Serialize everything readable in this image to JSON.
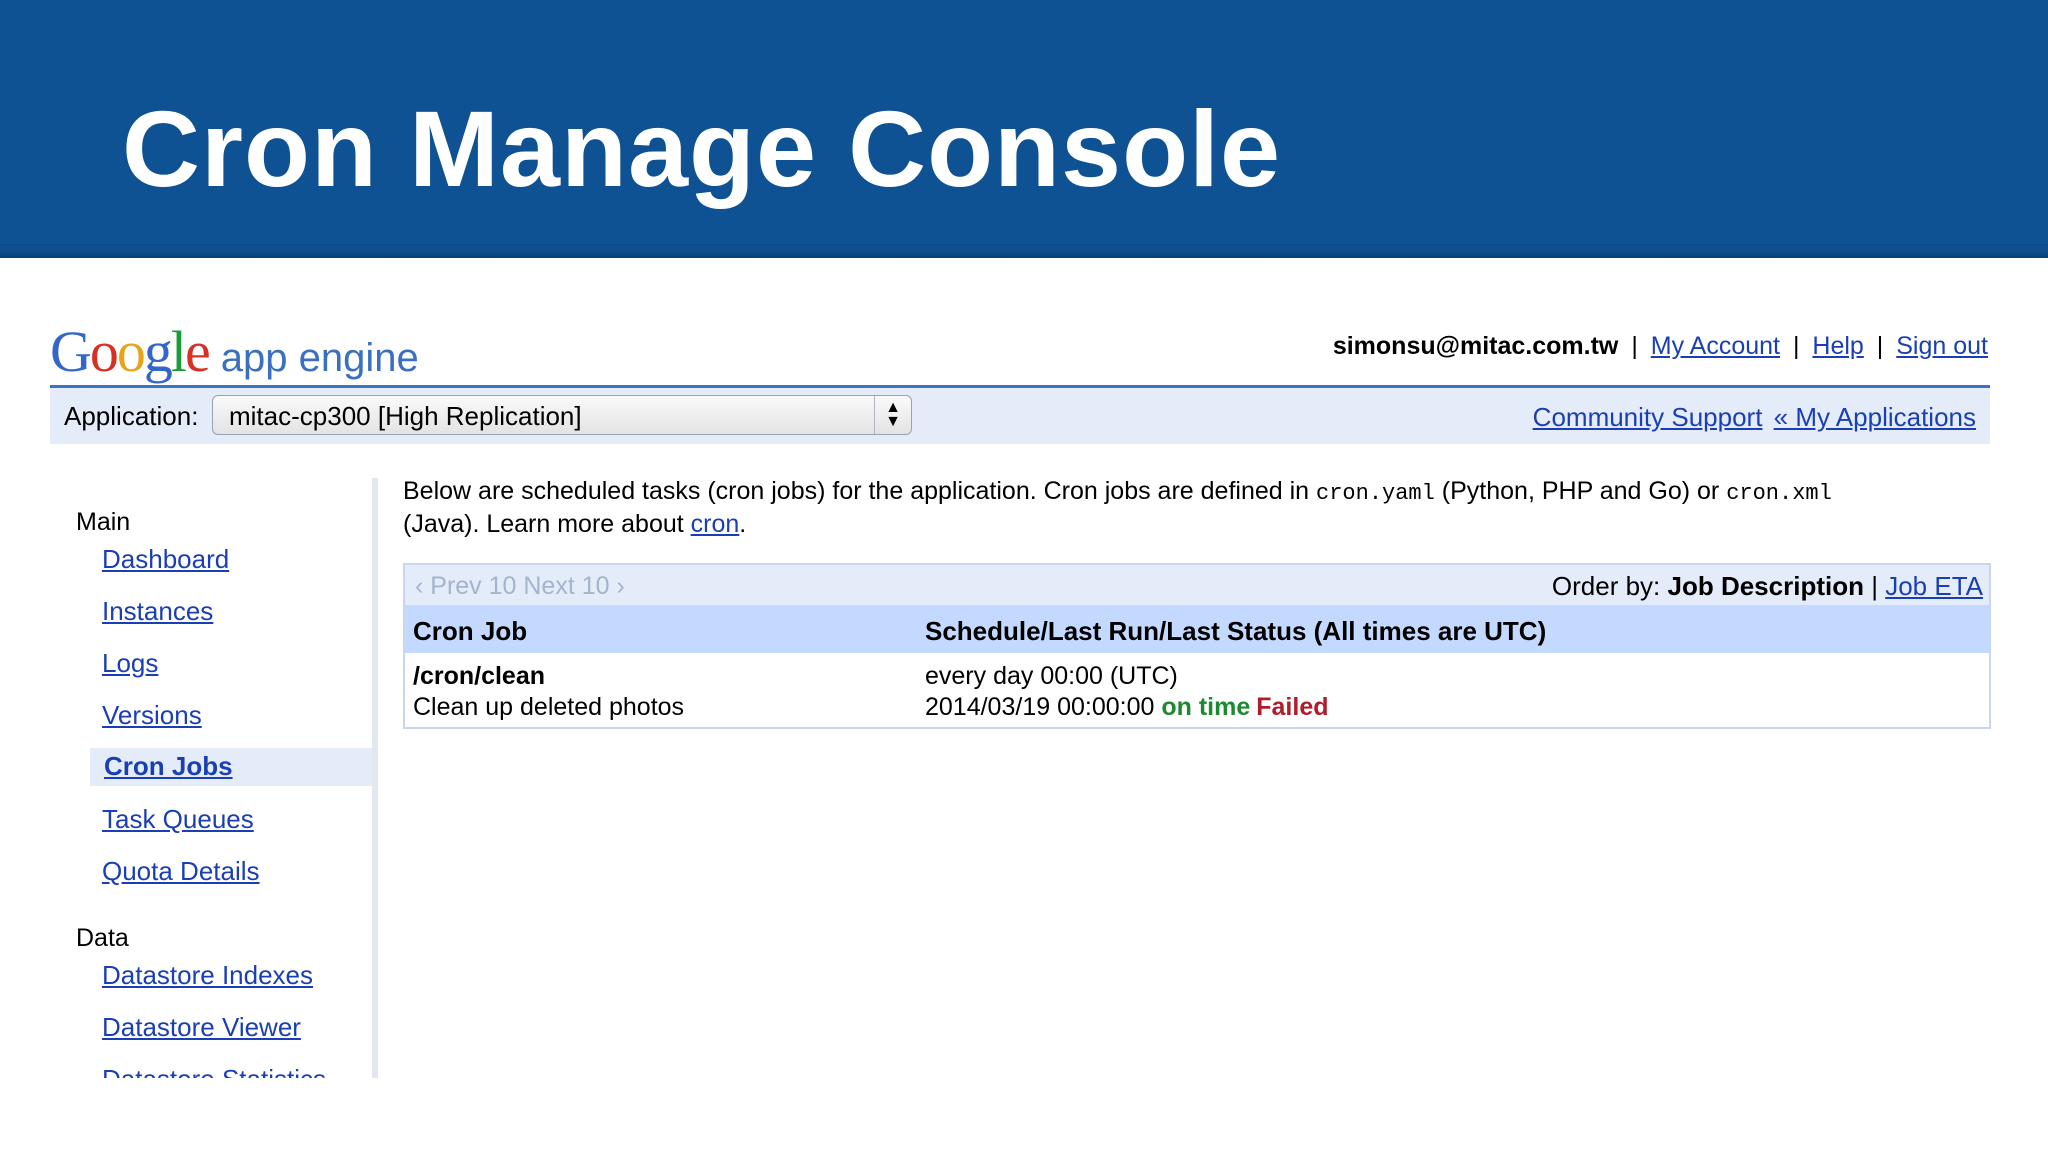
{
  "slide": {
    "title": "Cron Manage Console"
  },
  "header": {
    "logo_google": "Google",
    "logo_appengine": "app engine",
    "user_email": "simonsu@mitac.com.tw",
    "links": {
      "my_account": "My Account",
      "help": "Help",
      "sign_out": "Sign out"
    },
    "separator": "|"
  },
  "app_bar": {
    "label": "Application:",
    "selected_app": "mitac-cp300 [High Replication]",
    "community_support": "Community Support",
    "my_applications": "« My Applications"
  },
  "sidebar": {
    "sections": [
      {
        "title": "Main",
        "items": [
          "Dashboard",
          "Instances",
          "Logs",
          "Versions",
          "Cron Jobs",
          "Task Queues",
          "Quota Details"
        ]
      },
      {
        "title": "Data",
        "items": [
          "Datastore Indexes",
          "Datastore Viewer",
          "Datastore Statistics"
        ]
      }
    ],
    "selected_item": "Cron Jobs"
  },
  "intro": {
    "text1": "Below are scheduled tasks (cron jobs) for the application. Cron jobs are defined in ",
    "file1": "cron.yaml",
    "text2": " (Python, PHP and Go) or ",
    "file2": "cron.xml",
    "text3": " (Java). Learn more about ",
    "link": "cron",
    "text4": "."
  },
  "pager": {
    "prev_next": "‹ Prev 10 Next 10 ›",
    "order_by_label": "Order by:",
    "order_by_current": "Job Description",
    "order_by_alt": "Job ETA"
  },
  "table": {
    "columns": [
      "Cron Job",
      "Schedule/Last Run/Last Status (All times are UTC)"
    ],
    "rows": [
      {
        "url": "/cron/clean",
        "description": "Clean up deleted photos",
        "schedule": "every day 00:00 (UTC)",
        "last_run": "2014/03/19 00:00:00",
        "on_time": "on time",
        "status": "Failed"
      }
    ]
  },
  "colors": {
    "banner": "#0e5294",
    "link": "#1a3fb4",
    "bar_bg": "#e5ecf9",
    "table_header": "#c3d9ff",
    "ok": "#1e8a2e",
    "fail": "#b01d2a"
  }
}
